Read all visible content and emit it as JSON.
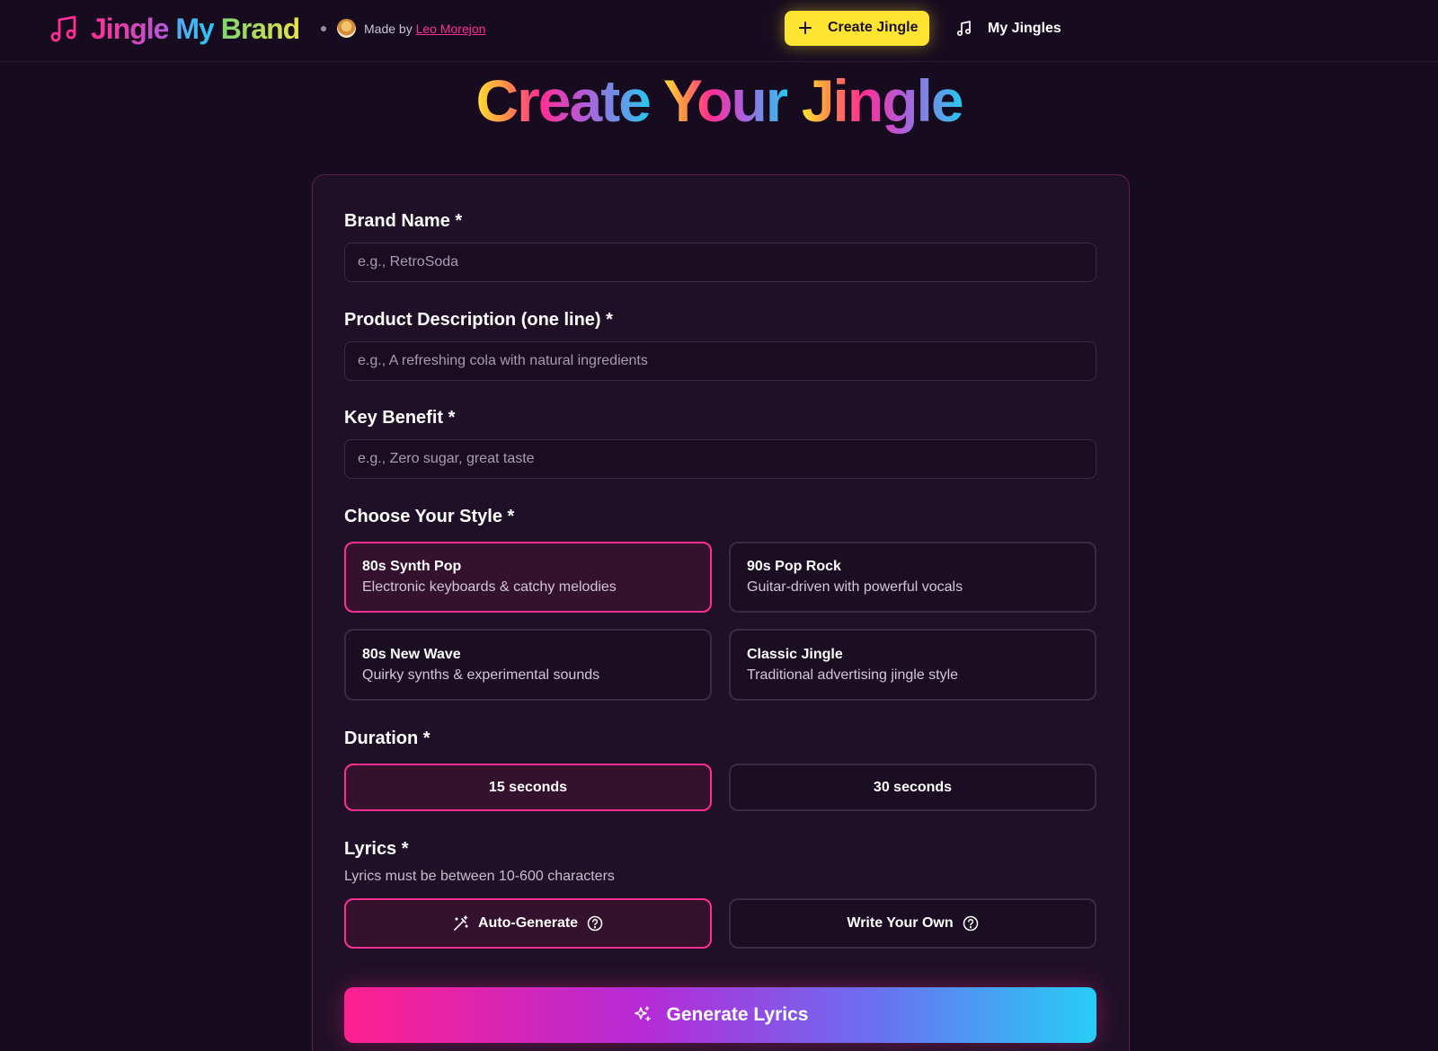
{
  "header": {
    "brand_word1": "Jingle",
    "brand_word2": "My",
    "brand_word3": "Brand",
    "made_by_prefix": "Made by",
    "made_by_name": "Leo Morejon",
    "create_button": "Create Jingle",
    "my_jingles": "My Jingles"
  },
  "title": {
    "word1": "Create",
    "word2": "Your",
    "word3": "Jingle"
  },
  "form": {
    "brand_name": {
      "label": "Brand Name *",
      "placeholder": "e.g., RetroSoda",
      "value": ""
    },
    "product_description": {
      "label": "Product Description (one line) *",
      "placeholder": "e.g., A refreshing cola with natural ingredients",
      "value": ""
    },
    "key_benefit": {
      "label": "Key Benefit *",
      "placeholder": "e.g., Zero sugar, great taste",
      "value": ""
    },
    "style": {
      "label": "Choose Your Style *",
      "options": [
        {
          "title": "80s Synth Pop",
          "desc": "Electronic keyboards & catchy melodies",
          "selected": true
        },
        {
          "title": "90s Pop Rock",
          "desc": "Guitar-driven with powerful vocals",
          "selected": false
        },
        {
          "title": "80s New Wave",
          "desc": "Quirky synths & experimental sounds",
          "selected": false
        },
        {
          "title": "Classic Jingle",
          "desc": "Traditional advertising jingle style",
          "selected": false
        }
      ]
    },
    "duration": {
      "label": "Duration *",
      "options": [
        {
          "label": "15 seconds",
          "selected": true
        },
        {
          "label": "30 seconds",
          "selected": false
        }
      ]
    },
    "lyrics": {
      "label": "Lyrics *",
      "hint": "Lyrics must be between 10-600 characters",
      "options": [
        {
          "label": "Auto-Generate",
          "icon": "magic-wand-icon",
          "selected": true
        },
        {
          "label": "Write Your Own",
          "icon": "",
          "selected": false
        }
      ]
    },
    "generate_button": "Generate Lyrics"
  },
  "colors": {
    "background": "#170b1f",
    "accent_pink": "#ff2e93",
    "accent_yellow": "#ffe431",
    "accent_cyan": "#27c7f0"
  }
}
